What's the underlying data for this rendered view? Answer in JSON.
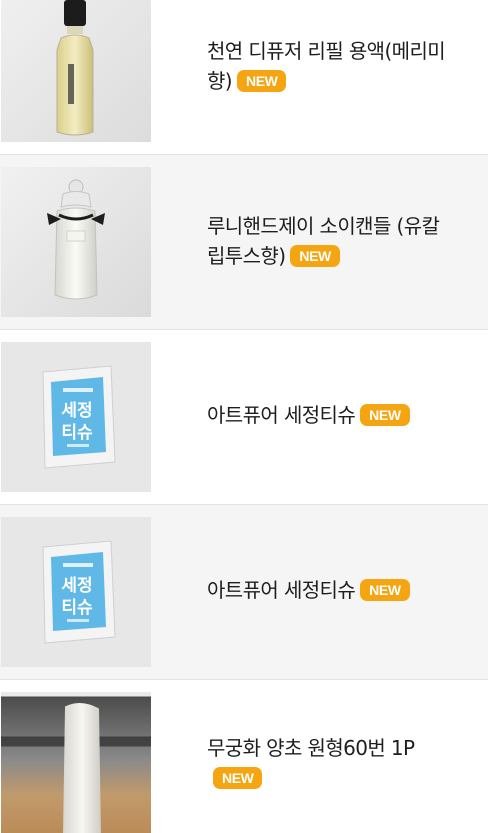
{
  "products": [
    {
      "name": "천연 디퓨저 리필 용액(메리미향)",
      "title_lines": [
        "천연 디퓨저 리필 용액(메리미",
        "향)"
      ],
      "badge": "NEW",
      "thumbnail_icon": "diffuser-refill-bottle-photo"
    },
    {
      "name": "루니핸드제이 소이캔들 (유칼립투스향)",
      "title_lines": [
        "루니핸드제이 소이캔들 (유칼",
        "립투스향)"
      ],
      "badge": "NEW",
      "thumbnail_icon": "soy-candle-jar-photo"
    },
    {
      "name": "아트퓨어 세정티슈",
      "title_lines": [
        "아트퓨어 세정티슈"
      ],
      "badge": "NEW",
      "thumbnail_icon": "cleansing-tissue-pack-photo",
      "package_text": [
        "세정",
        "티슈"
      ]
    },
    {
      "name": "아트퓨어 세정티슈",
      "title_lines": [
        "아트퓨어 세정티슈"
      ],
      "badge": "NEW",
      "thumbnail_icon": "cleansing-tissue-pack-photo",
      "package_text": [
        "세정",
        "티슈"
      ]
    },
    {
      "name": "무궁화 양초 원형60번 1P",
      "title_lines": [
        "무궁화 양초 원형60번 1P"
      ],
      "badge": "NEW",
      "thumbnail_icon": "white-candle-photo"
    }
  ],
  "colors": {
    "badge_background": "#f5a511",
    "badge_text": "#ffffff",
    "alt_row_background": "#f5f5f5",
    "divider": "#e2e2e2"
  }
}
